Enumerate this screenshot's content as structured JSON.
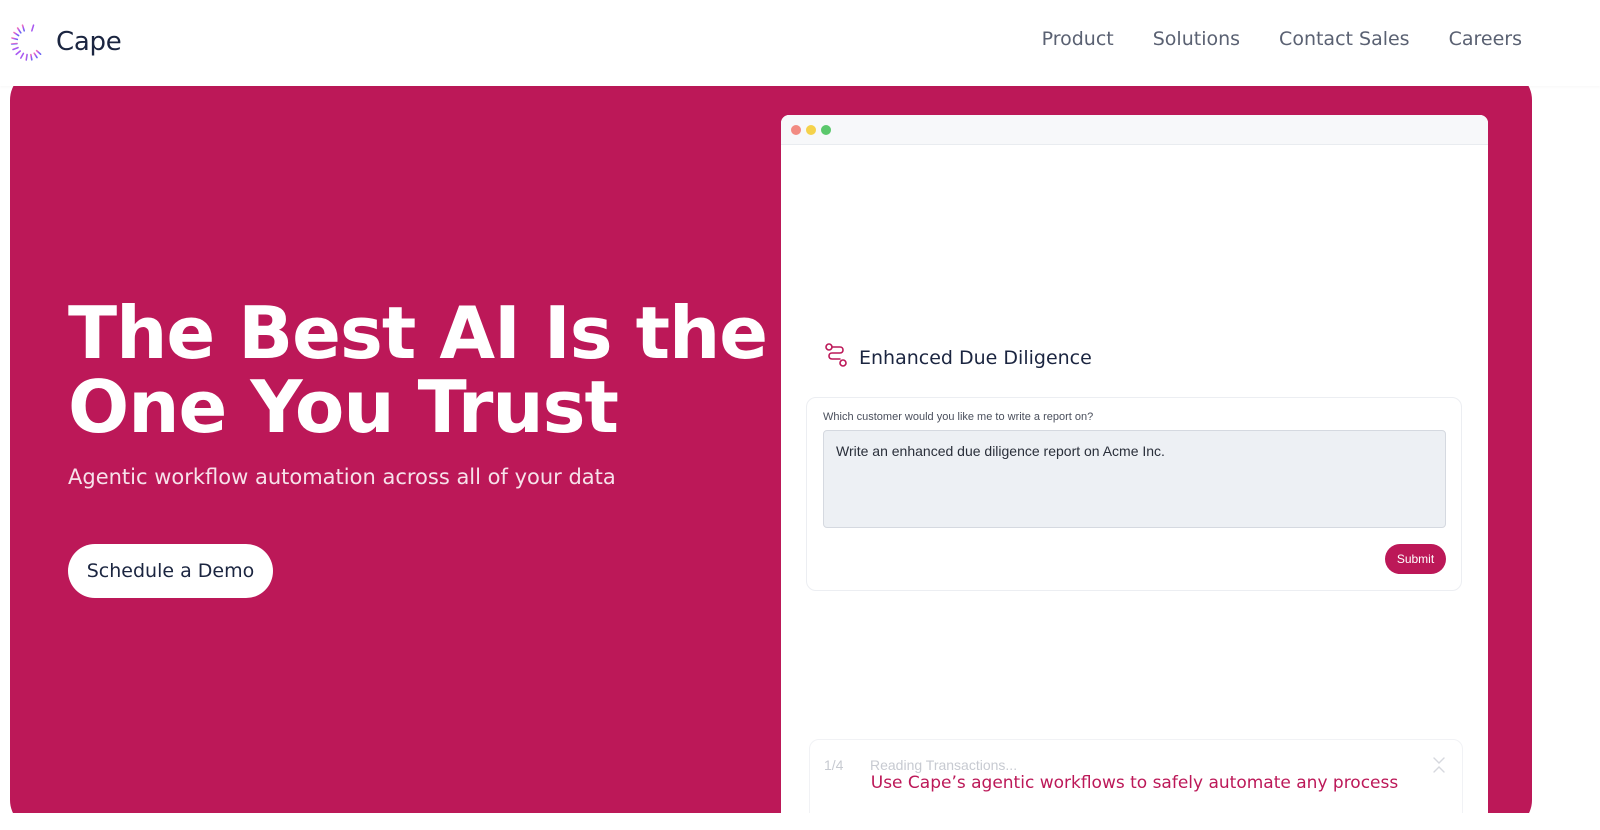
{
  "header": {
    "logo_text": "Cape",
    "nav": [
      "Product",
      "Solutions",
      "Contact Sales",
      "Careers"
    ]
  },
  "hero": {
    "title_line1": "The Best AI Is the",
    "title_line2": "One You Trust",
    "subtitle": "Agentic workflow automation across all of your data",
    "cta_label": "Schedule a Demo"
  },
  "mockup": {
    "workflow_title": "Enhanced Due Diligence",
    "question_label": "Which customer would you like me to write a report on?",
    "input_value": "Write an enhanced due diligence report on Acme Inc.",
    "submit_label": "Submit",
    "step_count": "1/4",
    "step_text": "Reading Transactions...",
    "caption": "Use Cape’s agentic workflows to safely automate any process"
  },
  "colors": {
    "brand": "#bc1858",
    "logo_gradient": [
      "#f472b6",
      "#a855f7",
      "#6366f1"
    ]
  },
  "icons": {
    "logo": "cape-spinner-logo-icon",
    "workflow": "workflow-route-icon",
    "close": "chevron-close-icon"
  }
}
